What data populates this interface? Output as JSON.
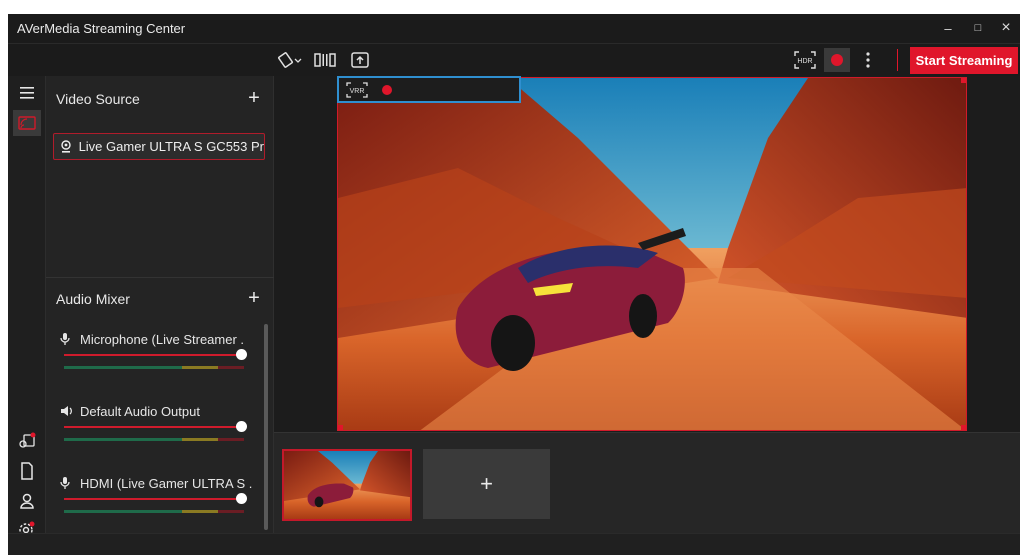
{
  "app": {
    "title": "AVerMedia Streaming Center"
  },
  "window_controls": {
    "minimize": "–",
    "maximize": "□",
    "close": "×"
  },
  "toolbar": {
    "start_streaming_label": "Start Streaming",
    "hdr_label": "HDR",
    "accent": "#e0162b"
  },
  "video_source": {
    "header": "Video Source",
    "items": [
      {
        "label": "Live Gamer ULTRA S GC553 Pr",
        "icon": "webcam-icon"
      }
    ]
  },
  "audio_mixer": {
    "header": "Audio Mixer",
    "items": [
      {
        "label": "Microphone (Live Streamer .",
        "icon": "microphone-icon",
        "level": 1.0
      },
      {
        "label": "Default Audio Output",
        "icon": "speaker-icon",
        "level": 1.0
      },
      {
        "label": "HDMI (Live Gamer ULTRA S .",
        "icon": "microphone-icon",
        "level": 1.0
      }
    ]
  },
  "preview": {
    "vrr_label": "VRR"
  },
  "scenes": {
    "add_label": "+"
  }
}
